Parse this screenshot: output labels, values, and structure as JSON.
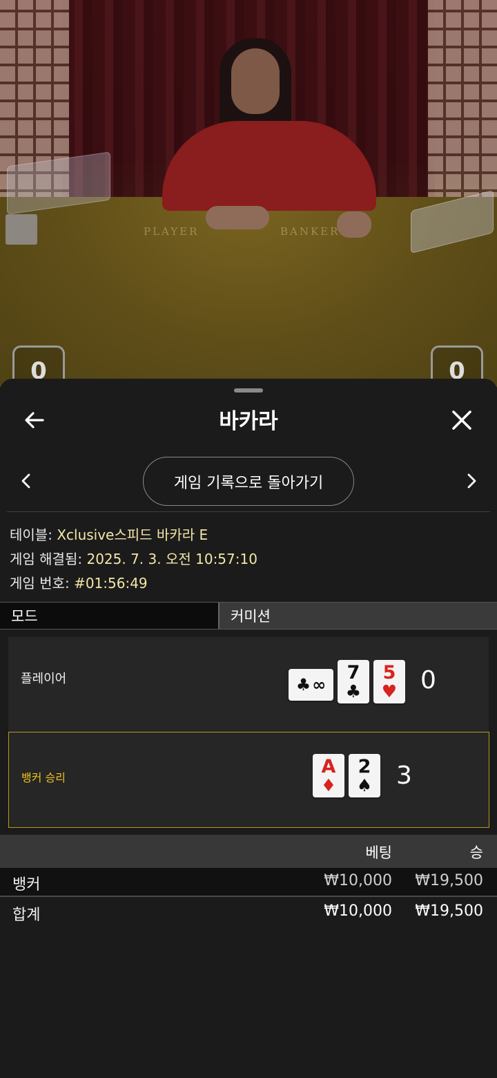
{
  "video": {
    "table_words": [
      "PLAYER",
      "BANKER"
    ],
    "player_score_stub": "0",
    "banker_score_stub": "0"
  },
  "sheet": {
    "title": "바카라",
    "back_icon": "arrow-left-icon",
    "close_icon": "close-icon",
    "history_button": "게임 기록으로 돌아가기",
    "prev_icon": "chevron-left-icon",
    "next_icon": "chevron-right-icon"
  },
  "info": {
    "table_label": "테이블:",
    "table_value": "Xclusive스피드 바카라 E",
    "resolved_label": "게임 해결됨:",
    "resolved_value": "2025. 7. 3. 오전 10:57:10",
    "number_label": "게임 번호:",
    "number_value": "#01:56:49"
  },
  "tabs": {
    "mode": "모드",
    "commission": "커미션"
  },
  "result": {
    "player_label": "플레이어",
    "player_cards": [
      {
        "rank": "∞",
        "suit": "♣",
        "color": "black",
        "orientation": "sideways"
      },
      {
        "rank": "7",
        "suit": "♣",
        "color": "black"
      },
      {
        "rank": "5",
        "suit": "♥",
        "color": "red"
      }
    ],
    "player_score": "0",
    "banker_label": "뱅커 승리",
    "banker_cards": [
      {
        "rank": "A",
        "suit": "♦",
        "color": "red"
      },
      {
        "rank": "2",
        "suit": "♠",
        "color": "black"
      }
    ],
    "banker_score": "3",
    "winner_highlight": "#b89a1c"
  },
  "bets": {
    "bet_header": "베팅",
    "win_header": "승",
    "rows": [
      {
        "name": "뱅커",
        "bet": "₩10,000",
        "win": "₩19,500"
      }
    ],
    "total": {
      "name": "합계",
      "bet": "₩10,000",
      "win": "₩19,500"
    }
  }
}
